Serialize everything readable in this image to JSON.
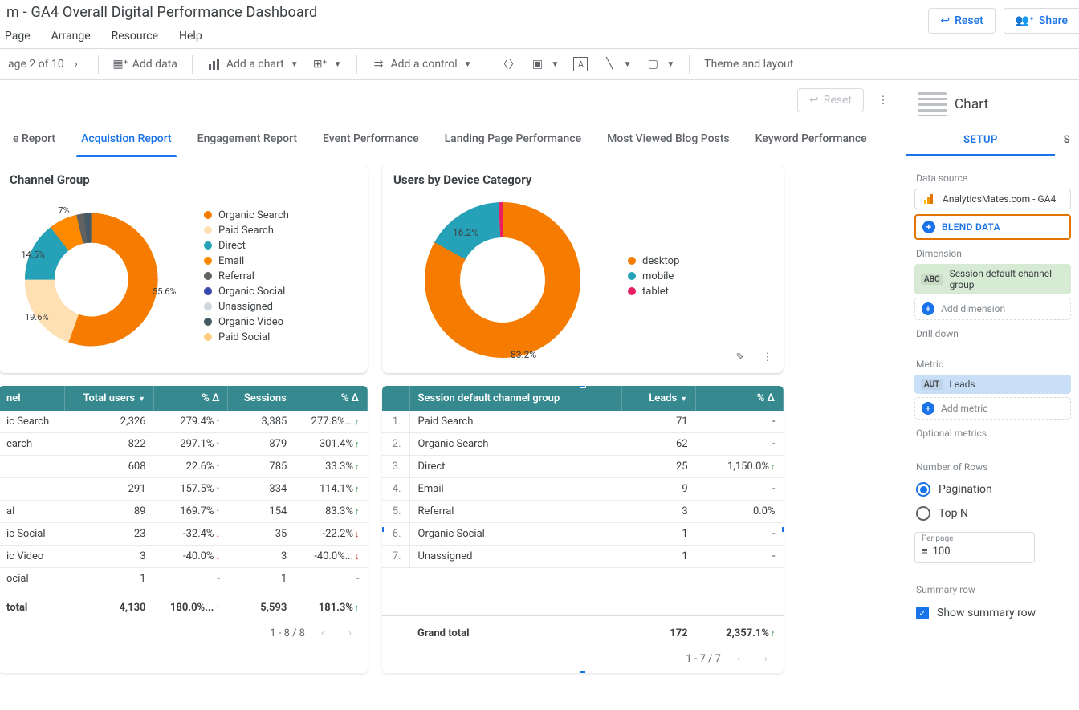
{
  "title": "m - GA4 Overall Digital Performance Dashboard",
  "top_actions": {
    "reset": "Reset",
    "share": "Share"
  },
  "menu": [
    "Page",
    "Arrange",
    "Resource",
    "Help"
  ],
  "toolbar": {
    "page_indicator": "age 2 of 10",
    "add_data": "Add data",
    "add_chart": "Add a chart",
    "add_control": "Add a control",
    "theme": "Theme and layout"
  },
  "canvas": {
    "reset": "Reset"
  },
  "tabs": [
    "e Report",
    "Acquistion Report",
    "Engagement Report",
    "Event Performance",
    "Landing Page Performance",
    "Most Viewed Blog Posts",
    "Keyword Performance"
  ],
  "active_tab": 1,
  "card_left_title": "Channel Group",
  "card_right_title": "Users by Device Category",
  "chart_data": [
    {
      "type": "pie",
      "title": "Channel Group",
      "series": [
        {
          "name": "Organic Search",
          "value": 55.6,
          "color": "#f57c00"
        },
        {
          "name": "Paid Search",
          "value": 19.6,
          "color": "#ffe0b2"
        },
        {
          "name": "Direct",
          "value": 14.5,
          "color": "#26a2b8"
        },
        {
          "name": "Email",
          "value": 7.0,
          "color": "#ff8a00"
        },
        {
          "name": "Referral",
          "value": 1.5,
          "color": "#616161"
        },
        {
          "name": "Organic Social",
          "value": 0.8,
          "color": "#3949ab"
        },
        {
          "name": "Unassigned",
          "value": 0.5,
          "color": "#cfd8dc"
        },
        {
          "name": "Organic Video",
          "value": 0.3,
          "color": "#455a64"
        },
        {
          "name": "Paid Social",
          "value": 0.2,
          "color": "#ffcc80"
        }
      ],
      "labels_shown": [
        "55.6%",
        "19.6%",
        "14.5%",
        "7%"
      ]
    },
    {
      "type": "pie",
      "title": "Users by Device Category",
      "series": [
        {
          "name": "desktop",
          "value": 83.2,
          "color": "#f57c00"
        },
        {
          "name": "mobile",
          "value": 16.2,
          "color": "#26a2b8"
        },
        {
          "name": "tablet",
          "value": 0.6,
          "color": "#e91e63"
        }
      ],
      "labels_shown": [
        "83.2%",
        "16.2%"
      ]
    }
  ],
  "table_left": {
    "cols": [
      "nel",
      "Total users",
      "% Δ",
      "Sessions",
      "% Δ"
    ],
    "rows": [
      {
        "label": "ic Search",
        "users": "2,326",
        "ud": "279.4%",
        "udir": "up",
        "sess": "3,385",
        "sd": "277.8%...",
        "sdir": "up"
      },
      {
        "label": "earch",
        "users": "822",
        "ud": "297.1%",
        "udir": "up",
        "sess": "879",
        "sd": "301.4%",
        "sdir": "up"
      },
      {
        "label": "",
        "users": "608",
        "ud": "22.6%",
        "udir": "up",
        "sess": "785",
        "sd": "33.3%",
        "sdir": "up"
      },
      {
        "label": "",
        "users": "291",
        "ud": "157.5%",
        "udir": "up",
        "sess": "334",
        "sd": "114.1%",
        "sdir": "up"
      },
      {
        "label": "al",
        "users": "89",
        "ud": "169.7%",
        "udir": "up",
        "sess": "154",
        "sd": "83.3%",
        "sdir": "up"
      },
      {
        "label": "ic Social",
        "users": "23",
        "ud": "-32.4%",
        "udir": "down",
        "sess": "35",
        "sd": "-22.2%",
        "sdir": "down"
      },
      {
        "label": "ic Video",
        "users": "3",
        "ud": "-40.0%",
        "udir": "down",
        "sess": "3",
        "sd": "-40.0%...",
        "sdir": "down"
      },
      {
        "label": "ocial",
        "users": "1",
        "ud": "-",
        "udir": "",
        "sess": "1",
        "sd": "-",
        "sdir": ""
      }
    ],
    "grand": {
      "label": "total",
      "users": "4,130",
      "ud": "180.0%...",
      "udir": "up",
      "sess": "5,593",
      "sd": "181.3%",
      "sdir": "up"
    },
    "pager": "1 - 8 / 8"
  },
  "table_right": {
    "cols": [
      "",
      "Session default channel group",
      "Leads",
      "% Δ"
    ],
    "rows": [
      {
        "i": "1.",
        "label": "Paid Search",
        "leads": "71",
        "delta": "-"
      },
      {
        "i": "2.",
        "label": "Organic Search",
        "leads": "62",
        "delta": "-"
      },
      {
        "i": "3.",
        "label": "Direct",
        "leads": "25",
        "delta": "1,150.0%",
        "dir": "up"
      },
      {
        "i": "4.",
        "label": "Email",
        "leads": "9",
        "delta": "-"
      },
      {
        "i": "5.",
        "label": "Referral",
        "leads": "3",
        "delta": "0.0%"
      },
      {
        "i": "6.",
        "label": "Organic Social",
        "leads": "1",
        "delta": "-"
      },
      {
        "i": "7.",
        "label": "Unassigned",
        "leads": "1",
        "delta": "-"
      }
    ],
    "grand": {
      "label": "Grand total",
      "leads": "172",
      "delta": "2,357.1%",
      "dir": "up"
    },
    "pager": "1 - 7 / 7"
  },
  "panel": {
    "title": "Chart",
    "tab": "SETUP",
    "data_source_label": "Data source",
    "data_source": "AnalyticsMates.com - GA4",
    "blend": "BLEND DATA",
    "dimension_label": "Dimension",
    "dimension": "Session default channel group",
    "add_dimension": "Add dimension",
    "drill_label": "Drill down",
    "metric_label": "Metric",
    "metric": "Leads",
    "add_metric": "Add metric",
    "optional_label": "Optional metrics",
    "rows_label": "Number of Rows",
    "pagination": "Pagination",
    "topn": "Top N",
    "perpage_label": "Per page",
    "perpage": "100",
    "summary_label": "Summary row",
    "show_summary": "Show summary row"
  }
}
